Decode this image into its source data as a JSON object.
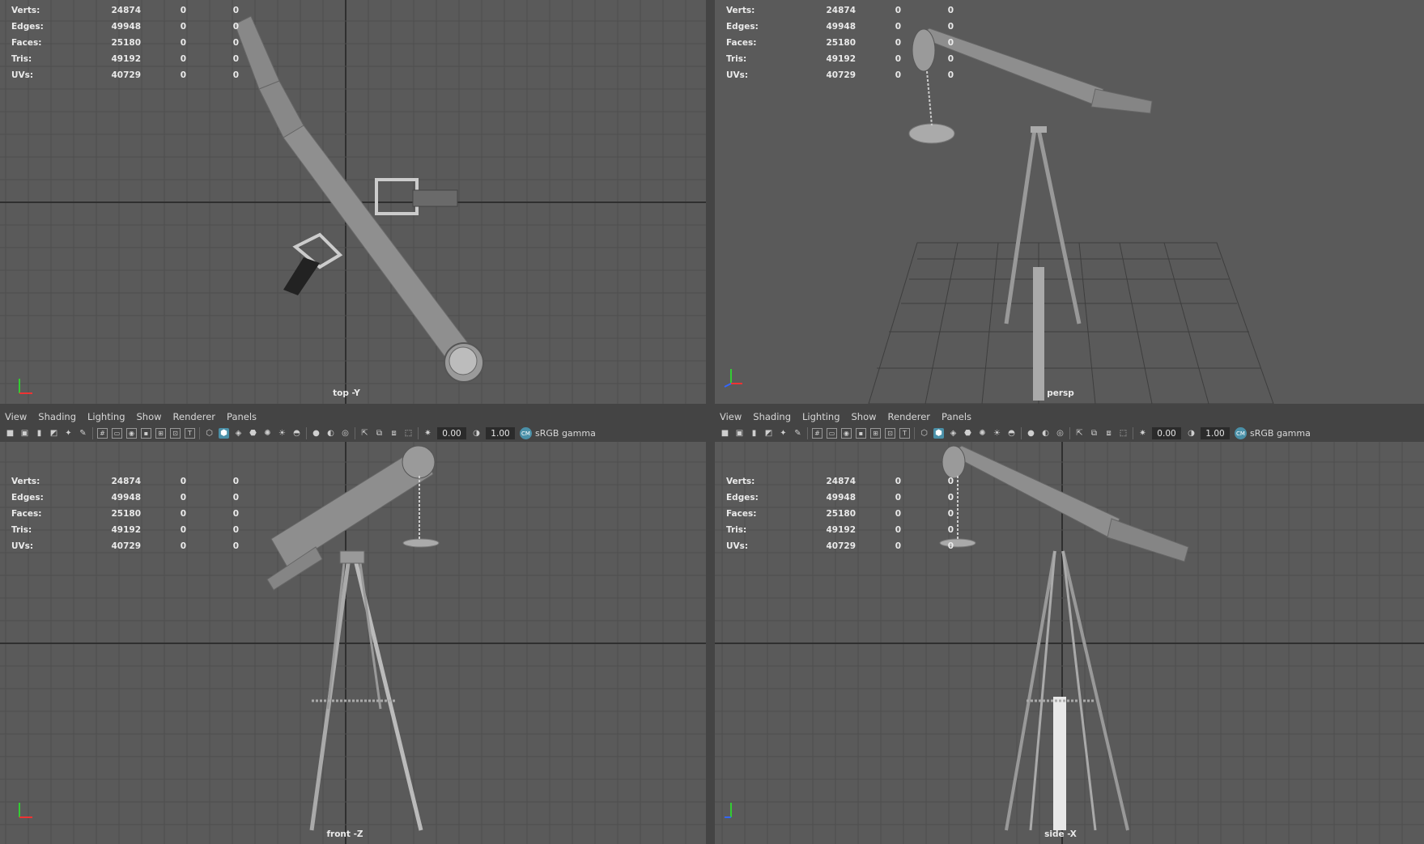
{
  "hud_stats": [
    {
      "label": "Verts:",
      "v1": "24874",
      "v2": "0",
      "v3": "0"
    },
    {
      "label": "Edges:",
      "v1": "49948",
      "v2": "0",
      "v3": "0"
    },
    {
      "label": "Faces:",
      "v1": "25180",
      "v2": "0",
      "v3": "0"
    },
    {
      "label": "Tris:",
      "v1": "49192",
      "v2": "0",
      "v3": "0"
    },
    {
      "label": "UVs:",
      "v1": "40729",
      "v2": "0",
      "v3": "0"
    }
  ],
  "viewports": {
    "top": {
      "camera": "top -Y"
    },
    "persp": {
      "camera": "persp"
    },
    "front": {
      "camera": "front -Z"
    },
    "side": {
      "camera": "side -X"
    }
  },
  "panel_menus": [
    "View",
    "Shading",
    "Lighting",
    "Show",
    "Renderer",
    "Panels"
  ],
  "toolbar": {
    "exposure": "0.00",
    "gamma": "1.00",
    "color_space": "sRGB gamma"
  },
  "icons": [
    "camera-icon",
    "camera-attributes-icon",
    "bookmark-icon",
    "image-plane-icon",
    "grid-icon",
    "film-gate-icon",
    "resolution-gate-icon",
    "wireframe-icon",
    "smooth-shade-icon",
    "textured-icon",
    "lights-icon",
    "shadows-icon",
    "xray-icon",
    "isolate-select-icon",
    "exposure-icon",
    "gamma-icon",
    "color-management-icon"
  ],
  "colors": {
    "viewport_bg": "#5a5a5a",
    "grid": "#4e4e4e",
    "grid_axis": "#2f2f2f",
    "model": "#8c8c8c",
    "accent": "#4a90a8"
  }
}
